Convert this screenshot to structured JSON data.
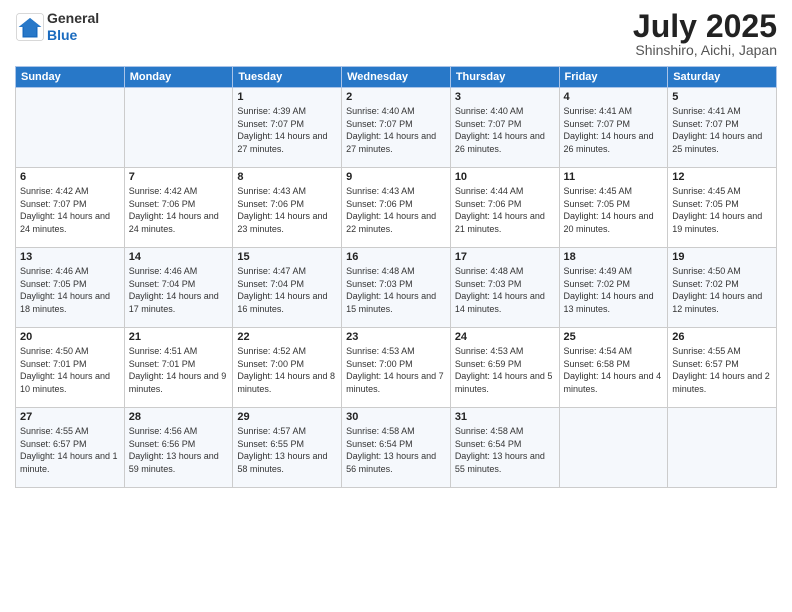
{
  "header": {
    "logo_general": "General",
    "logo_blue": "Blue",
    "title": "July 2025",
    "location": "Shinshiro, Aichi, Japan"
  },
  "days_of_week": [
    "Sunday",
    "Monday",
    "Tuesday",
    "Wednesday",
    "Thursday",
    "Friday",
    "Saturday"
  ],
  "weeks": [
    [
      {
        "day": "",
        "info": ""
      },
      {
        "day": "",
        "info": ""
      },
      {
        "day": "1",
        "info": "Sunrise: 4:39 AM\nSunset: 7:07 PM\nDaylight: 14 hours and 27 minutes."
      },
      {
        "day": "2",
        "info": "Sunrise: 4:40 AM\nSunset: 7:07 PM\nDaylight: 14 hours and 27 minutes."
      },
      {
        "day": "3",
        "info": "Sunrise: 4:40 AM\nSunset: 7:07 PM\nDaylight: 14 hours and 26 minutes."
      },
      {
        "day": "4",
        "info": "Sunrise: 4:41 AM\nSunset: 7:07 PM\nDaylight: 14 hours and 26 minutes."
      },
      {
        "day": "5",
        "info": "Sunrise: 4:41 AM\nSunset: 7:07 PM\nDaylight: 14 hours and 25 minutes."
      }
    ],
    [
      {
        "day": "6",
        "info": "Sunrise: 4:42 AM\nSunset: 7:07 PM\nDaylight: 14 hours and 24 minutes."
      },
      {
        "day": "7",
        "info": "Sunrise: 4:42 AM\nSunset: 7:06 PM\nDaylight: 14 hours and 24 minutes."
      },
      {
        "day": "8",
        "info": "Sunrise: 4:43 AM\nSunset: 7:06 PM\nDaylight: 14 hours and 23 minutes."
      },
      {
        "day": "9",
        "info": "Sunrise: 4:43 AM\nSunset: 7:06 PM\nDaylight: 14 hours and 22 minutes."
      },
      {
        "day": "10",
        "info": "Sunrise: 4:44 AM\nSunset: 7:06 PM\nDaylight: 14 hours and 21 minutes."
      },
      {
        "day": "11",
        "info": "Sunrise: 4:45 AM\nSunset: 7:05 PM\nDaylight: 14 hours and 20 minutes."
      },
      {
        "day": "12",
        "info": "Sunrise: 4:45 AM\nSunset: 7:05 PM\nDaylight: 14 hours and 19 minutes."
      }
    ],
    [
      {
        "day": "13",
        "info": "Sunrise: 4:46 AM\nSunset: 7:05 PM\nDaylight: 14 hours and 18 minutes."
      },
      {
        "day": "14",
        "info": "Sunrise: 4:46 AM\nSunset: 7:04 PM\nDaylight: 14 hours and 17 minutes."
      },
      {
        "day": "15",
        "info": "Sunrise: 4:47 AM\nSunset: 7:04 PM\nDaylight: 14 hours and 16 minutes."
      },
      {
        "day": "16",
        "info": "Sunrise: 4:48 AM\nSunset: 7:03 PM\nDaylight: 14 hours and 15 minutes."
      },
      {
        "day": "17",
        "info": "Sunrise: 4:48 AM\nSunset: 7:03 PM\nDaylight: 14 hours and 14 minutes."
      },
      {
        "day": "18",
        "info": "Sunrise: 4:49 AM\nSunset: 7:02 PM\nDaylight: 14 hours and 13 minutes."
      },
      {
        "day": "19",
        "info": "Sunrise: 4:50 AM\nSunset: 7:02 PM\nDaylight: 14 hours and 12 minutes."
      }
    ],
    [
      {
        "day": "20",
        "info": "Sunrise: 4:50 AM\nSunset: 7:01 PM\nDaylight: 14 hours and 10 minutes."
      },
      {
        "day": "21",
        "info": "Sunrise: 4:51 AM\nSunset: 7:01 PM\nDaylight: 14 hours and 9 minutes."
      },
      {
        "day": "22",
        "info": "Sunrise: 4:52 AM\nSunset: 7:00 PM\nDaylight: 14 hours and 8 minutes."
      },
      {
        "day": "23",
        "info": "Sunrise: 4:53 AM\nSunset: 7:00 PM\nDaylight: 14 hours and 7 minutes."
      },
      {
        "day": "24",
        "info": "Sunrise: 4:53 AM\nSunset: 6:59 PM\nDaylight: 14 hours and 5 minutes."
      },
      {
        "day": "25",
        "info": "Sunrise: 4:54 AM\nSunset: 6:58 PM\nDaylight: 14 hours and 4 minutes."
      },
      {
        "day": "26",
        "info": "Sunrise: 4:55 AM\nSunset: 6:57 PM\nDaylight: 14 hours and 2 minutes."
      }
    ],
    [
      {
        "day": "27",
        "info": "Sunrise: 4:55 AM\nSunset: 6:57 PM\nDaylight: 14 hours and 1 minute."
      },
      {
        "day": "28",
        "info": "Sunrise: 4:56 AM\nSunset: 6:56 PM\nDaylight: 13 hours and 59 minutes."
      },
      {
        "day": "29",
        "info": "Sunrise: 4:57 AM\nSunset: 6:55 PM\nDaylight: 13 hours and 58 minutes."
      },
      {
        "day": "30",
        "info": "Sunrise: 4:58 AM\nSunset: 6:54 PM\nDaylight: 13 hours and 56 minutes."
      },
      {
        "day": "31",
        "info": "Sunrise: 4:58 AM\nSunset: 6:54 PM\nDaylight: 13 hours and 55 minutes."
      },
      {
        "day": "",
        "info": ""
      },
      {
        "day": "",
        "info": ""
      }
    ]
  ]
}
